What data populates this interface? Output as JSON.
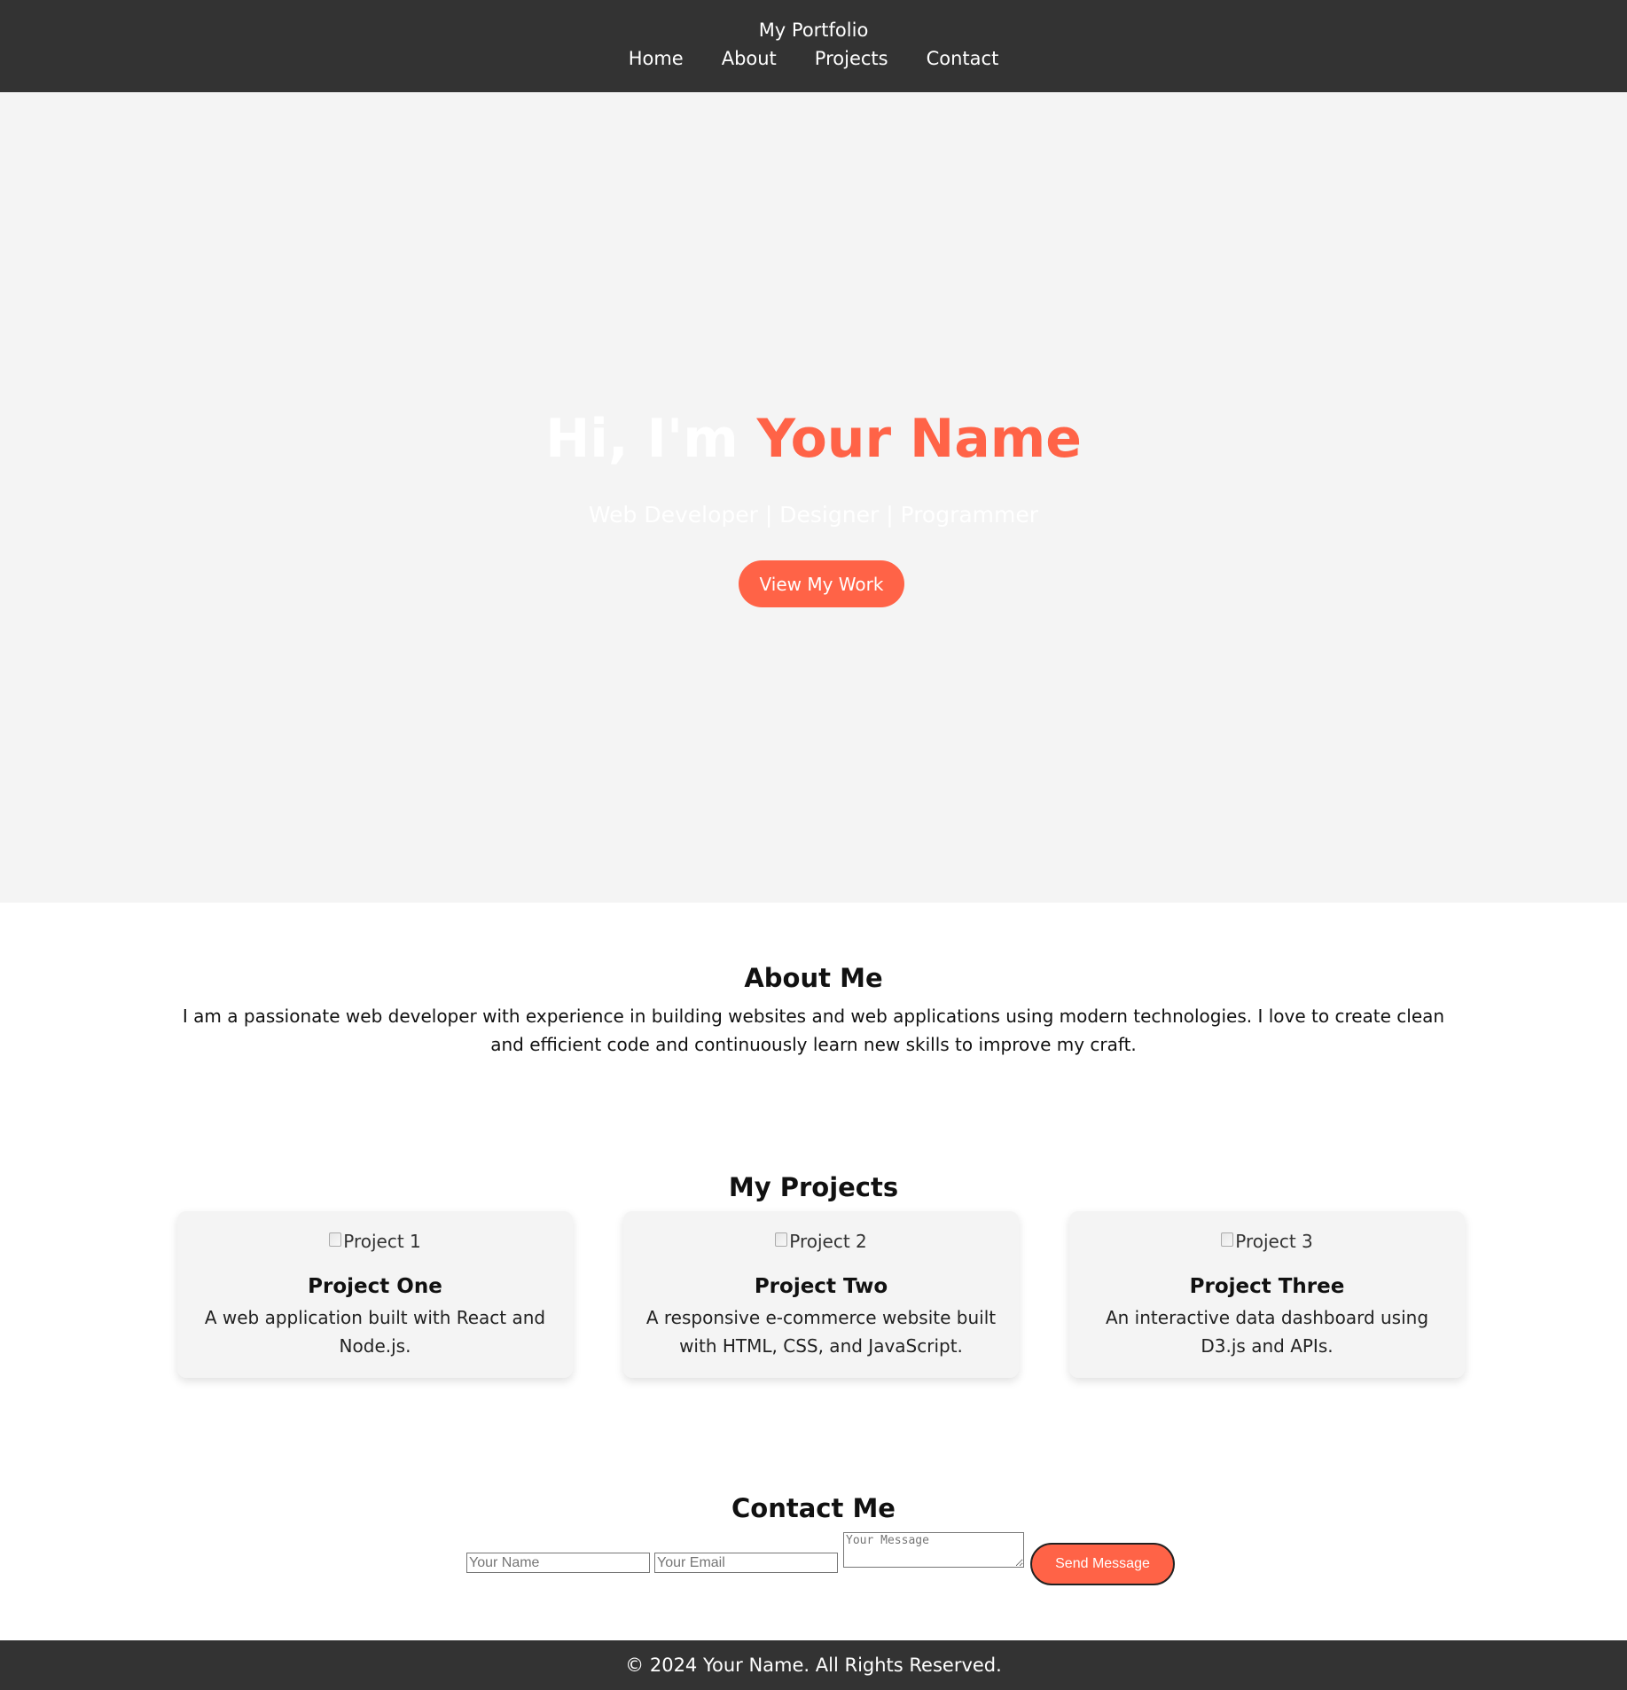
{
  "header": {
    "brand": "My Portfolio",
    "nav": [
      "Home",
      "About",
      "Projects",
      "Contact"
    ]
  },
  "hero": {
    "greeting": "Hi, I'm ",
    "name": "Your Name",
    "subtitle": "Web Developer | Designer | Programmer",
    "cta": "View My Work"
  },
  "about": {
    "title": "About Me",
    "text": "I am a passionate web developer with experience in building websites and web applications using modern technologies. I love to create clean and efficient code and continuously learn new skills to improve my craft."
  },
  "projects": {
    "title": "My Projects",
    "items": [
      {
        "image_alt": "Project 1",
        "title": "Project One",
        "description": "A web application built with React and Node.js."
      },
      {
        "image_alt": "Project 2",
        "title": "Project Two",
        "description": "A responsive e-commerce website built with HTML, CSS, and JavaScript."
      },
      {
        "image_alt": "Project 3",
        "title": "Project Three",
        "description": "An interactive data dashboard using D3.js and APIs."
      }
    ]
  },
  "contact": {
    "title": "Contact Me",
    "name_placeholder": "Your Name",
    "email_placeholder": "Your Email",
    "message_placeholder": "Your Message",
    "send_label": "Send Message"
  },
  "footer": {
    "text": "© 2024 Your Name. All Rights Reserved."
  },
  "colors": {
    "accent": "#ff6347",
    "header_bg": "#333333",
    "hero_bg": "#f4f4f4"
  }
}
